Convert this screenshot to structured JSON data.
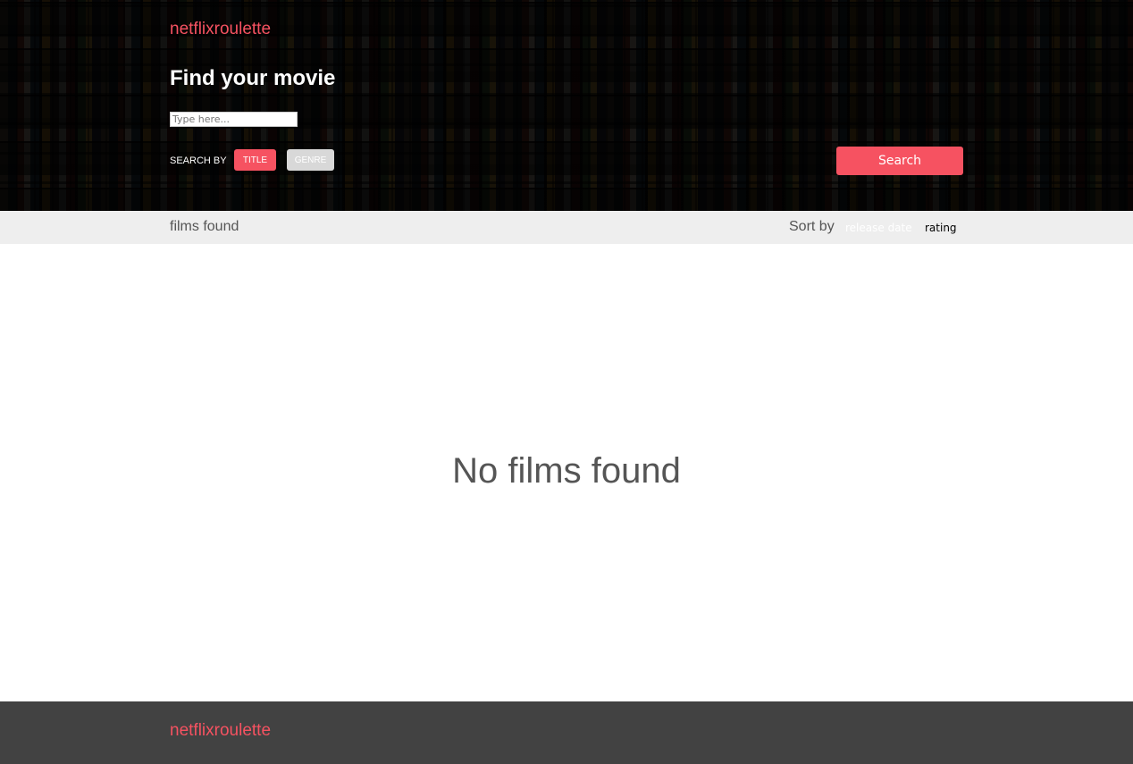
{
  "brand": {
    "logo_text": "netflixroulette",
    "accent_color": "#f65261"
  },
  "header": {
    "title": "Find your movie",
    "search": {
      "placeholder": "Type here...",
      "value": ""
    },
    "search_by": {
      "label": "SEARCH BY",
      "options": [
        {
          "label": "TITLE",
          "selected": true
        },
        {
          "label": "GENRE",
          "selected": false
        }
      ]
    },
    "search_button_label": "Search"
  },
  "results_bar": {
    "count_label": "films found",
    "sort": {
      "label": "Sort by",
      "options": [
        {
          "label": "release date",
          "selected": false
        },
        {
          "label": "rating",
          "selected": true
        }
      ]
    }
  },
  "main": {
    "empty_message": "No films found"
  },
  "footer": {
    "logo_text": "netflixroulette"
  }
}
